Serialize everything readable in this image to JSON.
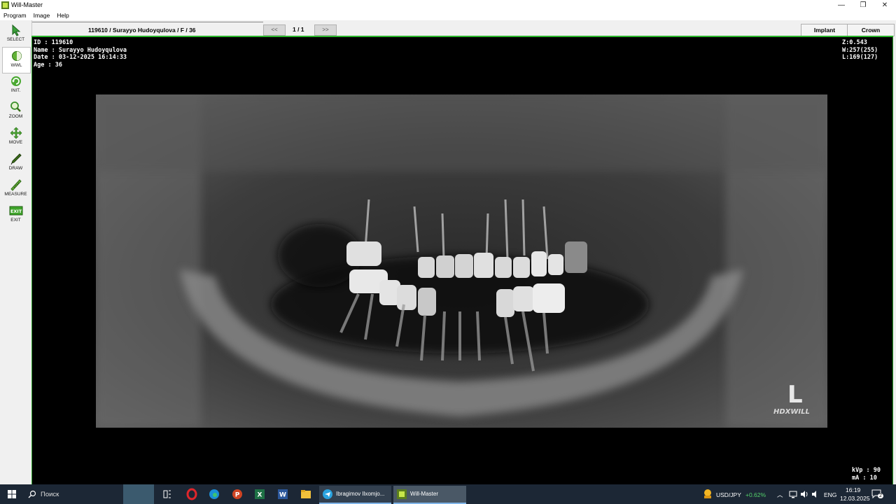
{
  "window": {
    "title": "Will-Master",
    "minimize": "—",
    "maximize": "❐",
    "close": "✕"
  },
  "menu": [
    "Program",
    "Image",
    "Help"
  ],
  "tools": [
    {
      "label": "SELECT",
      "icon": "arrow-select-icon"
    },
    {
      "label": "WWL",
      "icon": "window-level-icon"
    },
    {
      "label": "INIT.",
      "icon": "reset-icon"
    },
    {
      "label": "ZOOM",
      "icon": "magnifier-icon"
    },
    {
      "label": "MOVE",
      "icon": "move-arrows-icon"
    },
    {
      "label": "DRAW",
      "icon": "pen-icon"
    },
    {
      "label": "MEASURE",
      "icon": "ruler-icon"
    },
    {
      "label": "EXIT",
      "icon": "exit-icon",
      "badge": "EXIT"
    }
  ],
  "header": {
    "patient": "119610 / Surayyo Hudoyqulova / F / 36",
    "prev": "<<",
    "page": "1 / 1",
    "next": ">>",
    "tab_implant": "Implant",
    "tab_crown": "Crown"
  },
  "overlay": {
    "id": "ID : 119610",
    "name": "Name : Surayyo Hudoyqulova",
    "date": "Date : 03-12-2025 16:14:33",
    "age": "Age : 36",
    "zoom": "Z:0.543",
    "width": "W:257(255)",
    "level": "L:169(127)",
    "kvp": "kVp : 90",
    "ma": "mA : 10",
    "side": "L",
    "brand": "HDXWILL"
  },
  "taskbar": {
    "search": "Поиск",
    "app1": "Ibragimov Ilxomjo...",
    "app2": "Will-Master",
    "ticker": "USD/JPY",
    "change": "+0.62%",
    "lang": "ENG",
    "time": "16:19",
    "date": "12.03.2025",
    "notif": "2"
  }
}
